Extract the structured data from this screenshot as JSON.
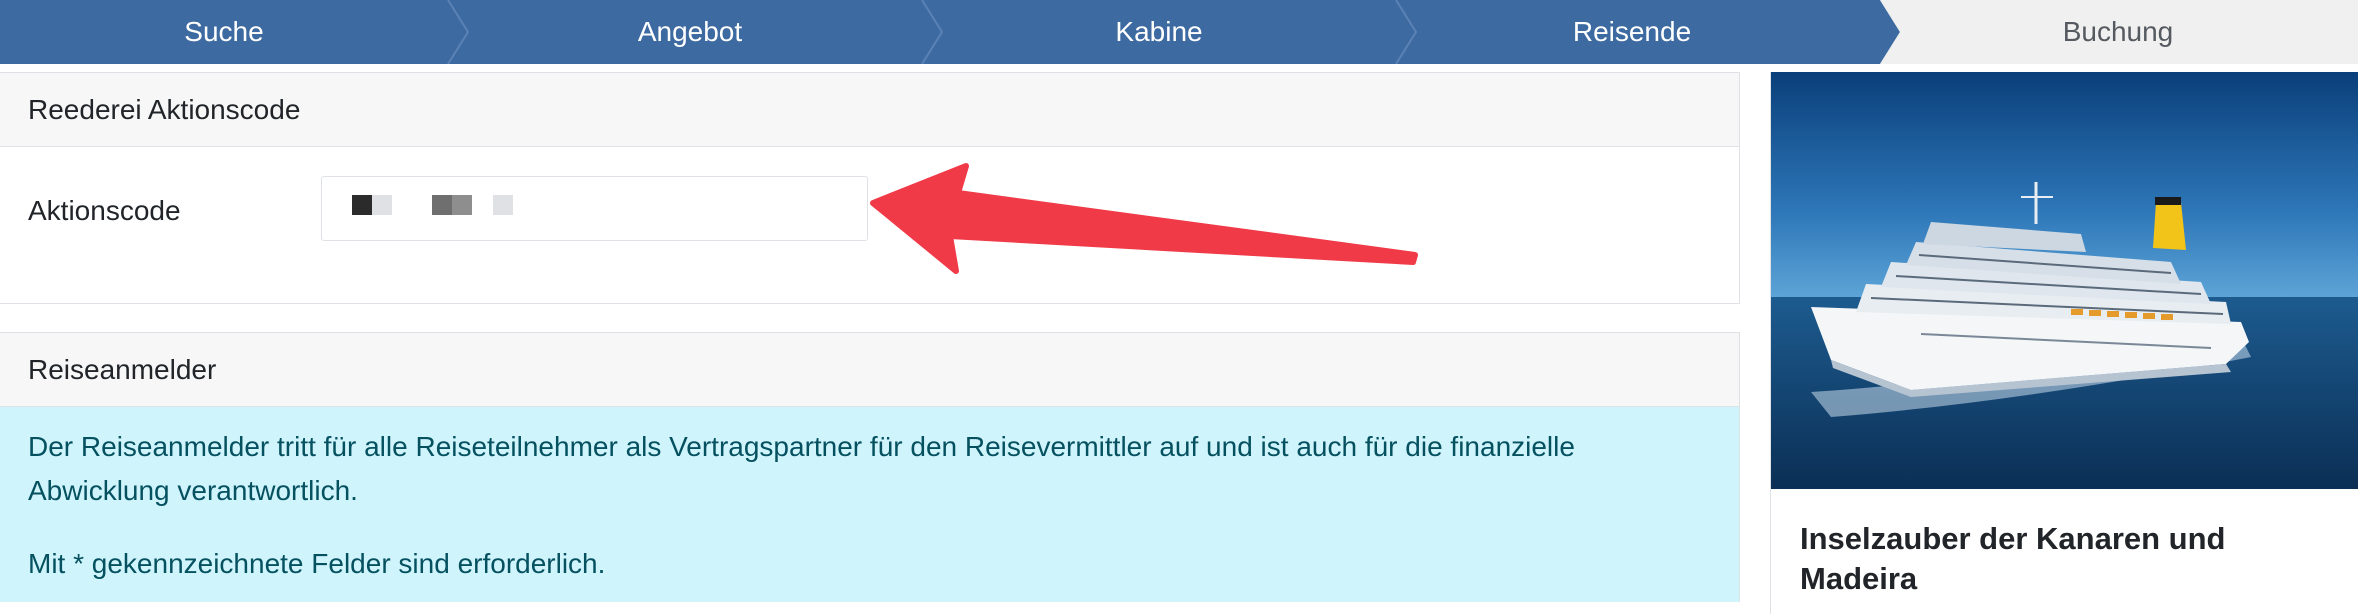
{
  "stepper": {
    "steps": [
      {
        "label": "Suche",
        "state": "done"
      },
      {
        "label": "Angebot",
        "state": "done"
      },
      {
        "label": "Kabine",
        "state": "done"
      },
      {
        "label": "Reisende",
        "state": "done"
      },
      {
        "label": "Buchung",
        "state": "current"
      }
    ],
    "colors": {
      "done": "#3d6aa1",
      "current": "#f0f0f0",
      "separator": "#5a82b5"
    }
  },
  "promo_card": {
    "title": "Reederei Aktionscode",
    "field_label": "Aktionscode",
    "field_value_redacted": true
  },
  "traveler_card": {
    "title": "Reiseanmelder",
    "info_text": "Der Reiseanmelder tritt für alle Reiseteilnehmer als Vertragspartner für den Reisevermittler auf und ist auch für die finanzielle Abwicklung verantwortlich.",
    "required_note": "Mit * gekennzeichnete Felder sind erforderlich.",
    "info_bg": "#cff4fc"
  },
  "sidebar": {
    "image_alt": "cruise-ship-photo",
    "trip_title": "Inselzauber der Kanaren und Madeira"
  },
  "annotation": {
    "type": "arrow",
    "color": "#f03a47"
  }
}
